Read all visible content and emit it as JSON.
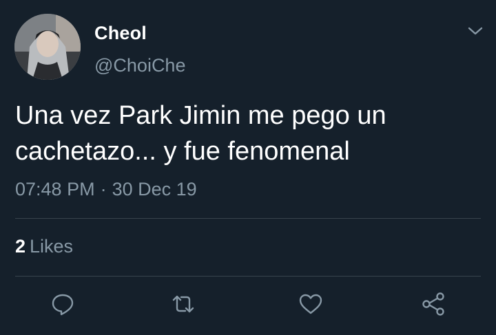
{
  "user": {
    "display_name": "Cheol",
    "handle": "@ChoiChe"
  },
  "tweet": {
    "text_line1": "Una vez Park Jimin me pego un",
    "text_line2": "cachetazo... y fue fenomenal",
    "time": "07:48 PM",
    "separator": "·",
    "date": "30 Dec 19"
  },
  "stats": {
    "likes_count": "2",
    "likes_label": "Likes"
  },
  "actions": {
    "icons": [
      "reply-icon",
      "retweet-icon",
      "like-icon",
      "share-icon"
    ]
  },
  "colors": {
    "background": "#15202b",
    "secondary_text": "#8899a6",
    "divider": "#38444d",
    "primary_text": "#ffffff"
  }
}
